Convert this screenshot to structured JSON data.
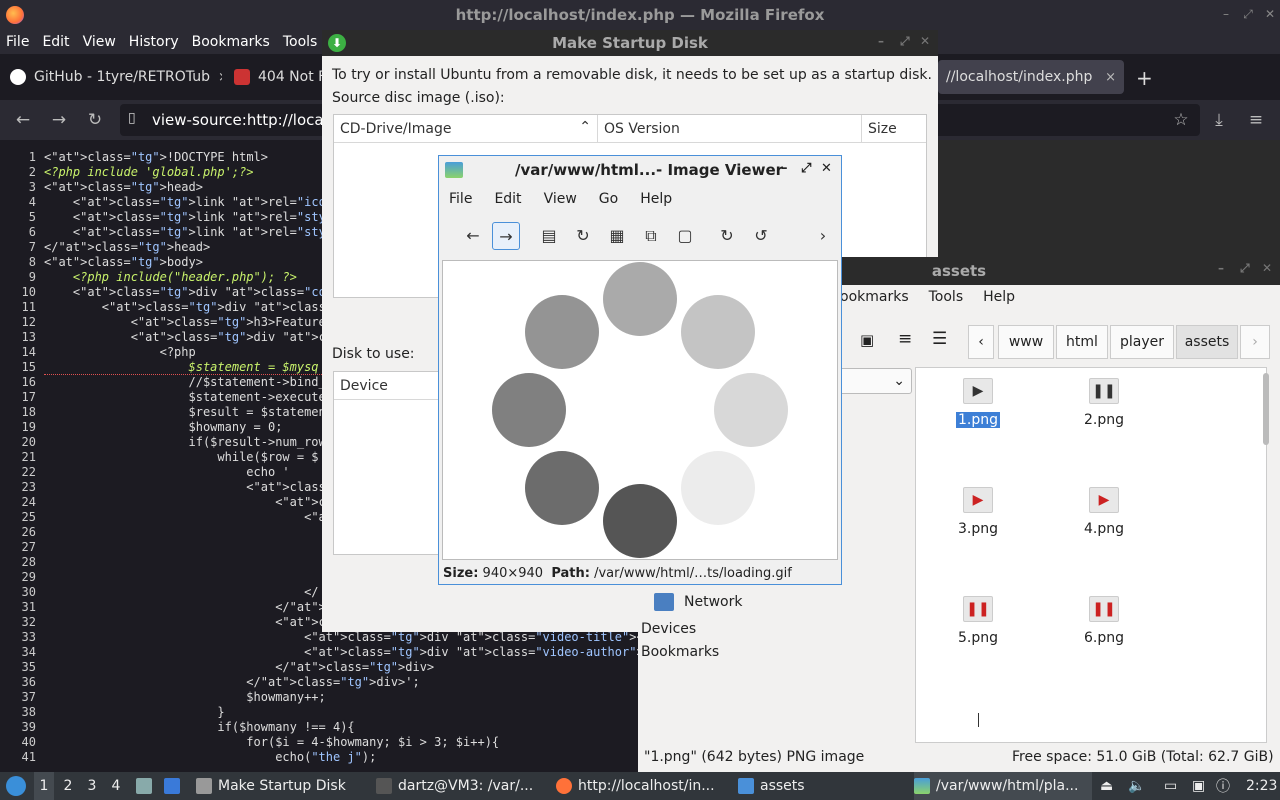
{
  "firefox": {
    "window_title": "http://localhost/index.php — Mozilla Firefox",
    "menu": [
      "File",
      "Edit",
      "View",
      "History",
      "Bookmarks",
      "Tools"
    ],
    "tabs": [
      {
        "label": "GitHub - 1tyre/RETROTub",
        "close": "×"
      },
      {
        "label": "404 Not F",
        "close": ""
      },
      {
        "label": "//localhost/index.php",
        "close": "×"
      }
    ],
    "new_tab": "+",
    "url": "view-source:http://locall"
  },
  "source": {
    "line_numbers": [
      "1",
      "2",
      "3",
      "4",
      "5",
      "6",
      "7",
      "8",
      "9",
      "10",
      "11",
      "12",
      "13",
      "14",
      "15",
      "16",
      "17",
      "18",
      "19",
      "20",
      "21",
      "22",
      "23",
      "24",
      "25",
      "26",
      "27",
      "28",
      "29",
      "30",
      "31",
      "32",
      "33",
      "34",
      "35",
      "36",
      "37",
      "38",
      "39",
      "40",
      "41"
    ],
    "lines": [
      "<!DOCTYPE html>",
      "<?php include 'global.php';?>",
      "<head>",
      "    <link rel=\"icon\" type=\"image/png\" h",
      "    <link rel=\"stylesheet\" type=\"text/c",
      "    <link rel=\"stylesheet\" type=\"text/c",
      "</head>",
      "<body>",
      "    <?php include(\"header.php\"); ?>",
      "    <div class=\"container-flex\">",
      "        <div class=\"col-2-3\">",
      "            <h3>Featured Videos</h3>",
      "            <div class=\"featured-video",
      "                <?php",
      "                    $statement = $mysq",
      "                    //$statement->bind_",
      "                    $statement->execute",
      "                    $result = $statemen",
      "                    $howmany = 0;",
      "                    if($result->num_row",
      "                        while($row = $",
      "                            echo '",
      "                            <div class",
      "                                <div c",
      "                                    <a",
      "",
      "",
      "",
      "",
      "                                    </",
      "                                </div>",
      "                                <div c",
      "                                    <div class=\"video-title\"><a href=\"viewvideo.ph",
      "                                    <div class=\"video-author\"><a href=\"profile.php",
      "                                </div>",
      "                            </div>';",
      "                            $howmany++;",
      "                        }",
      "                        if($howmany !== 4){",
      "                            for($i = 4-$howmany; $i > 3; $i++){",
      "                                echo(\"the j\");"
    ]
  },
  "startup_disk": {
    "title": "Make Startup Disk",
    "intro": "To try or install Ubuntu from a removable disk, it needs to be set up as a startup disk.",
    "source_label": "Source disc image (.iso):",
    "col_image": "CD-Drive/Image",
    "col_os": "OS Version",
    "col_size": "Size",
    "disk_label": "Disk to use:",
    "col_device": "Device"
  },
  "image_viewer": {
    "title": "/var/www/html...- Image Viewer",
    "menu": [
      "File",
      "Edit",
      "View",
      "Go",
      "Help"
    ],
    "size_label": "Size:",
    "size_value": "940×940",
    "path_label": "Path:",
    "path_value": "/var/www/html/…ts/loading.gif"
  },
  "file_manager": {
    "title": "assets",
    "menu": [
      "ookmarks",
      "Tools",
      "Help"
    ],
    "breadcrumbs": [
      "www",
      "html",
      "player",
      "assets"
    ],
    "places": [
      "Network"
    ],
    "sections": [
      "Devices",
      "Bookmarks"
    ],
    "files": [
      {
        "name": "1.png",
        "glyph": "▶",
        "color": "#333333"
      },
      {
        "name": "2.png",
        "glyph": "❚❚",
        "color": "#333333"
      },
      {
        "name": "3.png",
        "glyph": "▶",
        "color": "#cc2222"
      },
      {
        "name": "4.png",
        "glyph": "▶",
        "color": "#cc2222"
      },
      {
        "name": "5.png",
        "glyph": "❚❚",
        "color": "#cc2222"
      },
      {
        "name": "6.png",
        "glyph": "❚❚",
        "color": "#cc2222"
      }
    ],
    "status_left": "\"1.png\" (642 bytes) PNG image",
    "status_right": "Free space: 51.0 GiB (Total: 62.7 GiB)"
  },
  "taskbar": {
    "workspaces": [
      "1",
      "2",
      "3",
      "4"
    ],
    "items": [
      "Make Startup Disk",
      "dartz@VM3: /var/...",
      "http://localhost/in...",
      "assets",
      "/var/www/html/pla..."
    ],
    "clock": "2:23"
  }
}
